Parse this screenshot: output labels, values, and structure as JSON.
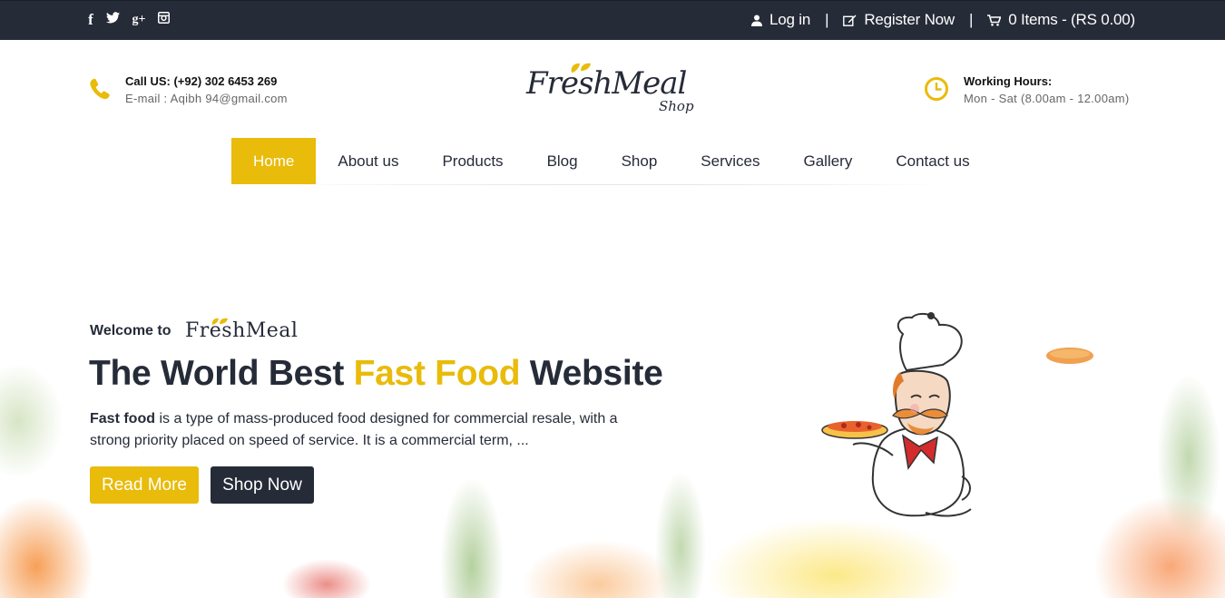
{
  "topbar": {
    "social": [
      {
        "icon": "facebook-icon",
        "glyph": "f"
      },
      {
        "icon": "twitter-icon",
        "glyph": ""
      },
      {
        "icon": "google-plus-icon",
        "glyph": "g+"
      },
      {
        "icon": "instagram-icon",
        "glyph": ""
      }
    ],
    "login_label": "Log in",
    "register_label": "Register Now",
    "cart_label": "0 Items - (RS 0.00)",
    "separator": "|"
  },
  "header": {
    "call": "Call US: (+92) 302 6453 269",
    "email": "E-mail : Aqibh 94@gmail.com",
    "logo_brand": "FreshMeal",
    "logo_sub": "Shop",
    "hours_title": "Working Hours:",
    "hours_value": "Mon - Sat (8.00am - 12.00am)"
  },
  "nav": {
    "items": [
      {
        "label": "Home",
        "active": true
      },
      {
        "label": "About us"
      },
      {
        "label": "Products"
      },
      {
        "label": "Blog"
      },
      {
        "label": "Shop"
      },
      {
        "label": "Services"
      },
      {
        "label": "Gallery"
      },
      {
        "label": "Contact us"
      }
    ]
  },
  "hero": {
    "welcome": "Welcome to",
    "welcome_brand": "FreshMeal",
    "headline_part1": "The World Best ",
    "headline_highlight": "Fast Food",
    "headline_part2": " Website",
    "desc_bold": "Fast food",
    "desc_rest": " is a type of mass-produced food designed for commercial resale, with a strong priority placed on speed of service. It is a commercial term, ...",
    "read_more_label": "Read More",
    "shop_now_label": "Shop Now"
  },
  "colors": {
    "accent": "#e9bb0a",
    "dark": "#262b38"
  }
}
